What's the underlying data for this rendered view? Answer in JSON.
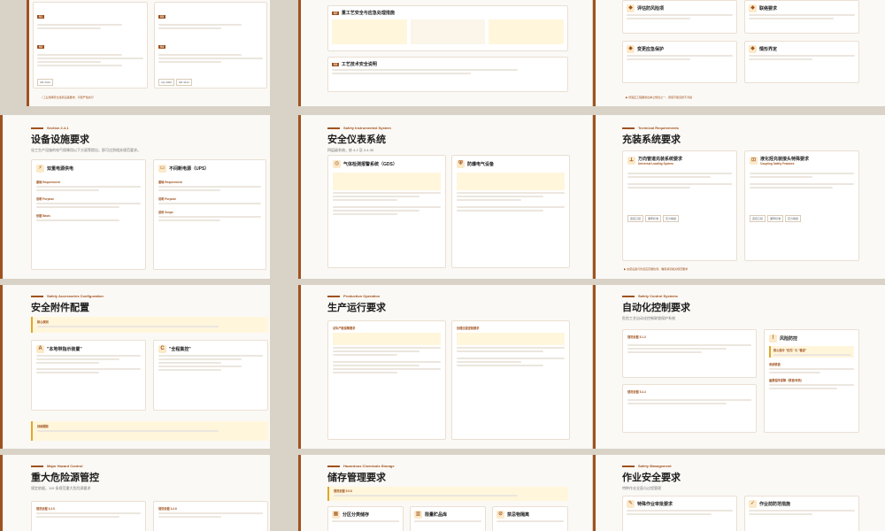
{
  "slides": {
    "s1": {
      "foot": "Ⅰ 工业隔爆安全级别设备要求，风险严格执行"
    },
    "s2": {
      "row2": "重工艺安全与应急处理措施",
      "row3": "工艺技术安全说明"
    },
    "s3": {
      "title1": "评估防风险项",
      "title2": "联络要求",
      "title3": "变更应急保护",
      "title4": "情形界定",
      "foot": "▶ 增强应工程要用在岸之规性之一，即使可能完整不清级"
    },
    "s4": {
      "eyebrow": "Section 2.4.1",
      "title": "设备设施要求",
      "subtitle": "化工生产设施的电气保障用以下方面等提出，即可达到相关规范要求。",
      "card1_title": "双重电源供电",
      "card2_title": "不间断电源（UPS）",
      "labels": [
        "基础 Requirement",
        "说明 Purpose",
        "依据 Basis",
        "适用 Scope"
      ]
    },
    "s5": {
      "eyebrow": "Safety Instrumented System",
      "title": "安全仪表系统",
      "subtitle": "四层级系统，依 4.2 及 4.4.35",
      "card1_title": "气体检测报警系统（GDS）",
      "card2_title": "防爆电气设备"
    },
    "s6": {
      "eyebrow": "Technical Requirements",
      "title": "充装系统要求",
      "card1_title": "万向管道充装系统要求",
      "card1_en": "Universal Loading System",
      "card2_title": "液化烃充装接头特殊要求",
      "card2_en": "Coupling Safety Features",
      "tags": [
        "连接口径",
        "漏率标准",
        "压力等级"
      ],
      "foot": "▶ 充装设备与管道应定期检测，确保满足相关规范要求"
    },
    "s7": {
      "eyebrow": "Safety Accessories Configuration",
      "title": "安全附件配置",
      "banner_title": "核心原则",
      "card1_title": "\"本地带指示装置\"",
      "card2_title": "\"全程集控\"",
      "note_title": "持续跟踪"
    },
    "s8": {
      "eyebrow": "Production Operation",
      "title": "生产运行要求",
      "card1_title": "试车产能保障要求",
      "card2_title": "处理过程控制要求"
    },
    "s9": {
      "eyebrow": "Safety Control Systems",
      "title": "自动化控制要求",
      "subtitle": "危险工艺自动化控制联锁保护系统",
      "sec1": "规范依据 5.1.3",
      "sec2": "规范依据 5.4.4",
      "side_title": "风险防控",
      "side_sub1": "核心指令 \"优先\" 与 \"稳妥\"",
      "side_sub2": "系统联锁",
      "side_sub3": "重要程序保障（联锁/有效）"
    },
    "s10": {
      "eyebrow": "Major Hazard Control",
      "title": "重大危险源管控",
      "subtitle": "规定依据，115 条规范重大危险源要求",
      "sec1": "规范依据 3.3.5",
      "sec2": "规范依据 3.3.6"
    },
    "s11": {
      "eyebrow": "Hazardous Chemicals Storage",
      "title": "储存管理要求",
      "banner": "规范依据 5.5.8",
      "card1_title": "分区分类储存",
      "card2_title": "限量贮品库",
      "card3_title": "禁忌物隔离"
    },
    "s12": {
      "eyebrow": "Safety Management",
      "title": "作业安全要求",
      "subtitle": "特种作业全面与过程管理",
      "card1_title": "特殊作业审批要求",
      "card2_title": "作业前防范措施"
    }
  }
}
